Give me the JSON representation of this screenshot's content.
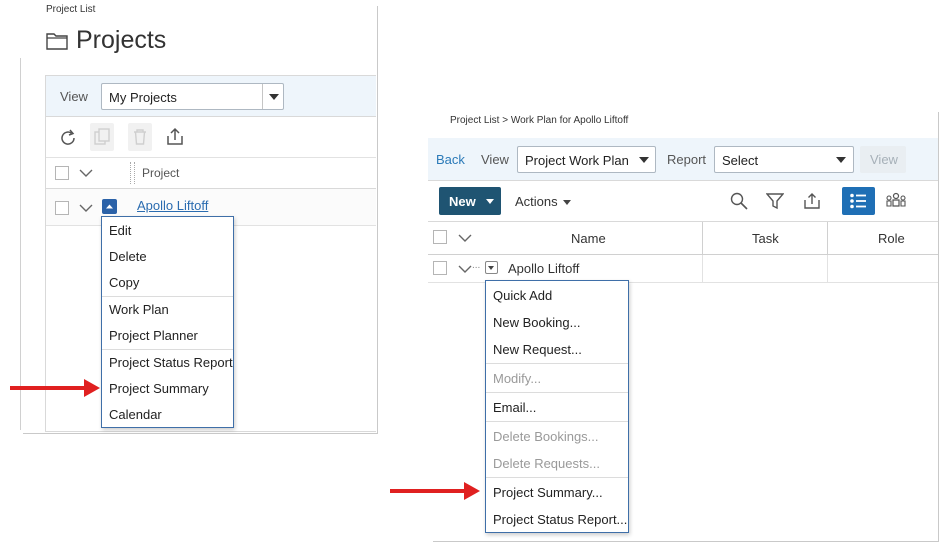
{
  "panel1": {
    "breadcrumb": "Project List",
    "title": "Projects",
    "view_label": "View",
    "view_select": "My Projects",
    "column_project": "Project",
    "row_name": "Apollo Liftoff",
    "menu": [
      "Edit",
      "Delete",
      "Copy",
      "Work Plan",
      "Project Planner",
      "Project Status Report",
      "Project Summary",
      "Calendar"
    ]
  },
  "panel2": {
    "breadcrumb": "Project List > Work Plan for Apollo Liftoff",
    "back": "Back",
    "view_label": "View",
    "view_select": "Project Work Plan",
    "report_label": "Report",
    "report_select": "Select",
    "view_button": "View",
    "new_button": "New",
    "actions_label": "Actions",
    "columns": [
      "Name",
      "Task",
      "Role"
    ],
    "row_name": "Apollo Liftoff",
    "menu": [
      "Quick Add",
      "New Booking...",
      "New Request...",
      "Modify...",
      "Email...",
      "Delete Bookings...",
      "Delete Requests...",
      "Project Summary...",
      "Project Status Report..."
    ]
  },
  "colors": {
    "accent": "#1f5472",
    "link": "#2b6cb0",
    "arrow": "#e02020",
    "menu_border": "#3f6fa8"
  }
}
